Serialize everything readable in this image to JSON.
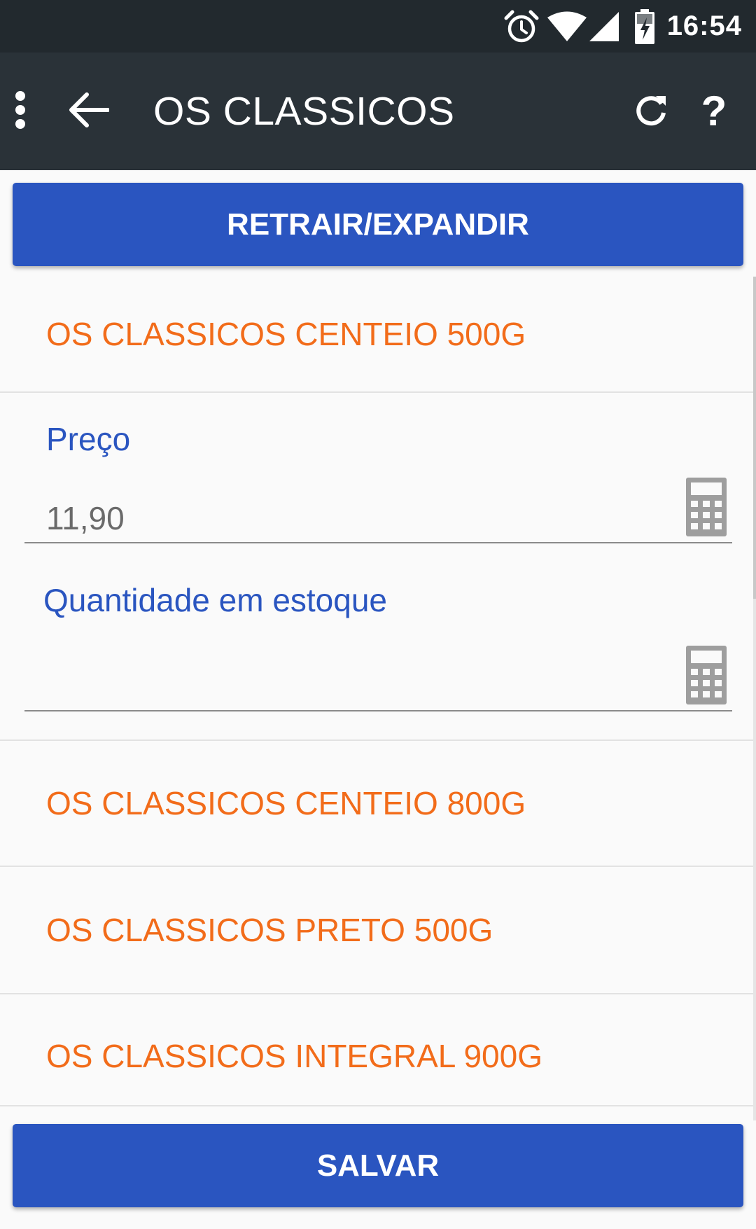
{
  "status_bar": {
    "time": "16:54",
    "icons": [
      "alarm-icon",
      "wifi-icon",
      "signal-icon",
      "battery-charging-icon"
    ]
  },
  "app_bar": {
    "title": "OS CLASSICOS",
    "icons": [
      "more-vert-icon",
      "arrow-back-icon",
      "refresh-icon",
      "help-icon"
    ],
    "help_glyph": "?"
  },
  "buttons": {
    "toggle_label": "RETRAIR/EXPANDIR",
    "save_label": "SALVAR"
  },
  "groups": [
    {
      "title": "OS CLASSICOS CENTEIO 500G",
      "expanded": true,
      "fields": [
        {
          "label": "Preço",
          "value": "11,90",
          "icon": "calculator-icon"
        },
        {
          "label": "Quantidade em estoque",
          "value": "",
          "icon": "calculator-icon"
        }
      ]
    },
    {
      "title": "OS CLASSICOS CENTEIO 800G",
      "expanded": false
    },
    {
      "title": "OS CLASSICOS PRETO 500G",
      "expanded": false
    },
    {
      "title": "OS CLASSICOS INTEGRAL 900G",
      "expanded": false
    }
  ],
  "colors": {
    "status_bar": "#22292e",
    "app_bar": "#2a3238",
    "primary": "#2a55c0",
    "group_title": "#f26c1a",
    "field_label": "#2a55c0",
    "background": "#fafafa"
  }
}
